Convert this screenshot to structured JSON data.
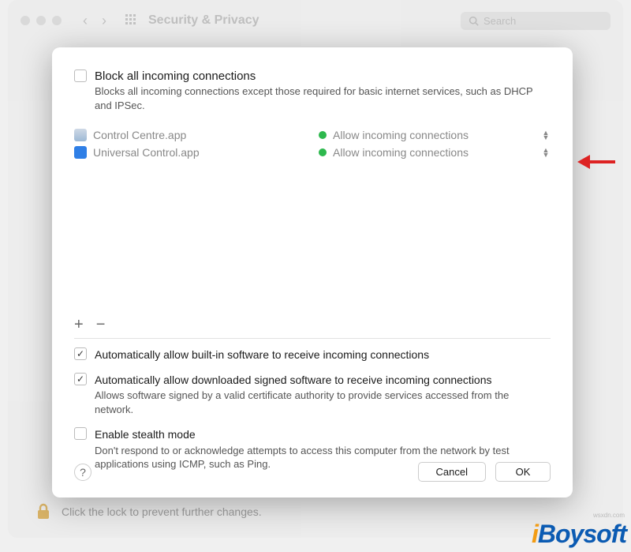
{
  "bg": {
    "title": "Security & Privacy",
    "search_placeholder": "Search",
    "lock_text": "Click the lock to prevent further changes."
  },
  "block_all": {
    "label": "Block all incoming connections",
    "desc": "Blocks all incoming connections except those required for basic internet services, such as DHCP and IPSec."
  },
  "apps": [
    {
      "name": "Control Centre.app",
      "status": "Allow incoming connections",
      "icon_color": "#9db9d6"
    },
    {
      "name": "Universal Control.app",
      "status": "Allow incoming connections",
      "icon_color": "#2f7fe6"
    }
  ],
  "add_label": "+",
  "remove_label": "−",
  "opt_auto_builtin": "Automatically allow built-in software to receive incoming connections",
  "opt_auto_signed": {
    "label": "Automatically allow downloaded signed software to receive incoming connections",
    "desc": "Allows software signed by a valid certificate authority to provide services accessed from the network."
  },
  "opt_stealth": {
    "label": "Enable stealth mode",
    "desc": "Don't respond to or acknowledge attempts to access this computer from the network by test applications using ICMP, such as Ping."
  },
  "help_label": "?",
  "cancel_label": "Cancel",
  "ok_label": "OK",
  "watermark": "iBoysoft",
  "wsx": "wsxdn.com"
}
